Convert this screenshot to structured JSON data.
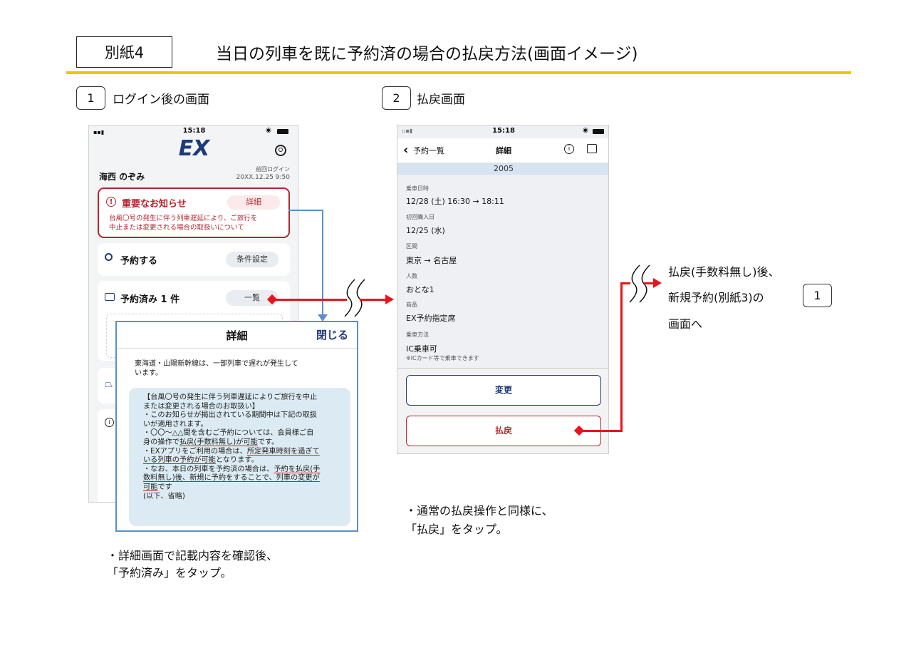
{
  "header": {
    "badge": "別紙4",
    "title": "当日の列車を既に予約済の場合の払戻方法(画面イメージ)"
  },
  "step1": {
    "number": "1",
    "label": "ログイン後の画面",
    "caption_line1": "・詳細画面で記載内容を確認後、",
    "caption_line2": "「予約済み」をタップ。"
  },
  "step2": {
    "number": "2",
    "label": "払戻画面",
    "caption_line1": "・通常の払戻操作と同様に、",
    "caption_line2": "「払戻」をタップ。"
  },
  "note_right": {
    "line1": "払戻(手数料無し)後、",
    "line2": "新規予約(別紙3)の",
    "box_number": "1",
    "line3": "画面へ"
  },
  "phone1": {
    "time": "15:18",
    "logo": "EX",
    "user_name": "海西 のぞみ",
    "last_login_label": "前回ログイン",
    "last_login_value": "20XX.12.25 9:50",
    "notice_title": "重要なお知らせ",
    "notice_detail_btn": "詳細",
    "notice_body_1": "台風〇号の発生に伴う列車遅延により、ご旅行を",
    "notice_body_2": "中止または変更される場合の取扱いについて",
    "reserve_label": "予約する",
    "reserve_btn": "条件設定",
    "booked_label": "予約済み 1 件",
    "booked_btn": "一覧"
  },
  "popup": {
    "title": "詳細",
    "close": "閉じる",
    "intro_1": "東海道・山陽新幹線は、一部列車で遅れが発生して",
    "intro_2": "います。",
    "body_1": "【台風〇号の発生に伴う列車遅延によりご旅行を中止",
    "body_2": "または変更される場合のお取扱い】",
    "body_3": "・このお知らせが掲出されている期間中は下記の取扱",
    "body_4": "いが適用されます。",
    "body_5": "・〇〇～△△間を含むご予約については、会員様ご自",
    "body_6a": "身の操作で",
    "body_6b": "払戻(手数料無し)が可能",
    "body_6c": "です。",
    "body_7a": "・EXアプリをご利用の場合は、",
    "body_7b": "所定発車時刻を過ぎて",
    "body_8a": "いる列車の予約が可能",
    "body_8b": "となります。",
    "body_9a": "・なお、本日の列車を予約済の場合は、",
    "body_9b": "予約を払戻(手",
    "body_10a": "数料無し)後、新規に予約をすることで、",
    "body_10b": "列車の変更が",
    "body_11a": "可能",
    "body_11b": "です",
    "body_12": "(以下、省略)"
  },
  "phone2": {
    "time": "15:18",
    "back": "予約一覧",
    "title": "詳細",
    "year": "2005",
    "ride_date_label": "乗車日時",
    "ride_date_value": "12/28 (土) 16:30 → 18:11",
    "purchase_label": "初回購入日",
    "purchase_value": "12/25 (水)",
    "section_label": "区間",
    "section_value": "東京 → 名古屋",
    "people_label": "人数",
    "people_value": "おとな1",
    "product_label": "商品",
    "product_value": "EX予約指定席",
    "method_label": "乗車方法",
    "method_value": "IC乗車可",
    "method_note": "※ICカード等で乗車できます",
    "change_btn": "変更",
    "refund_btn": "払戻"
  }
}
